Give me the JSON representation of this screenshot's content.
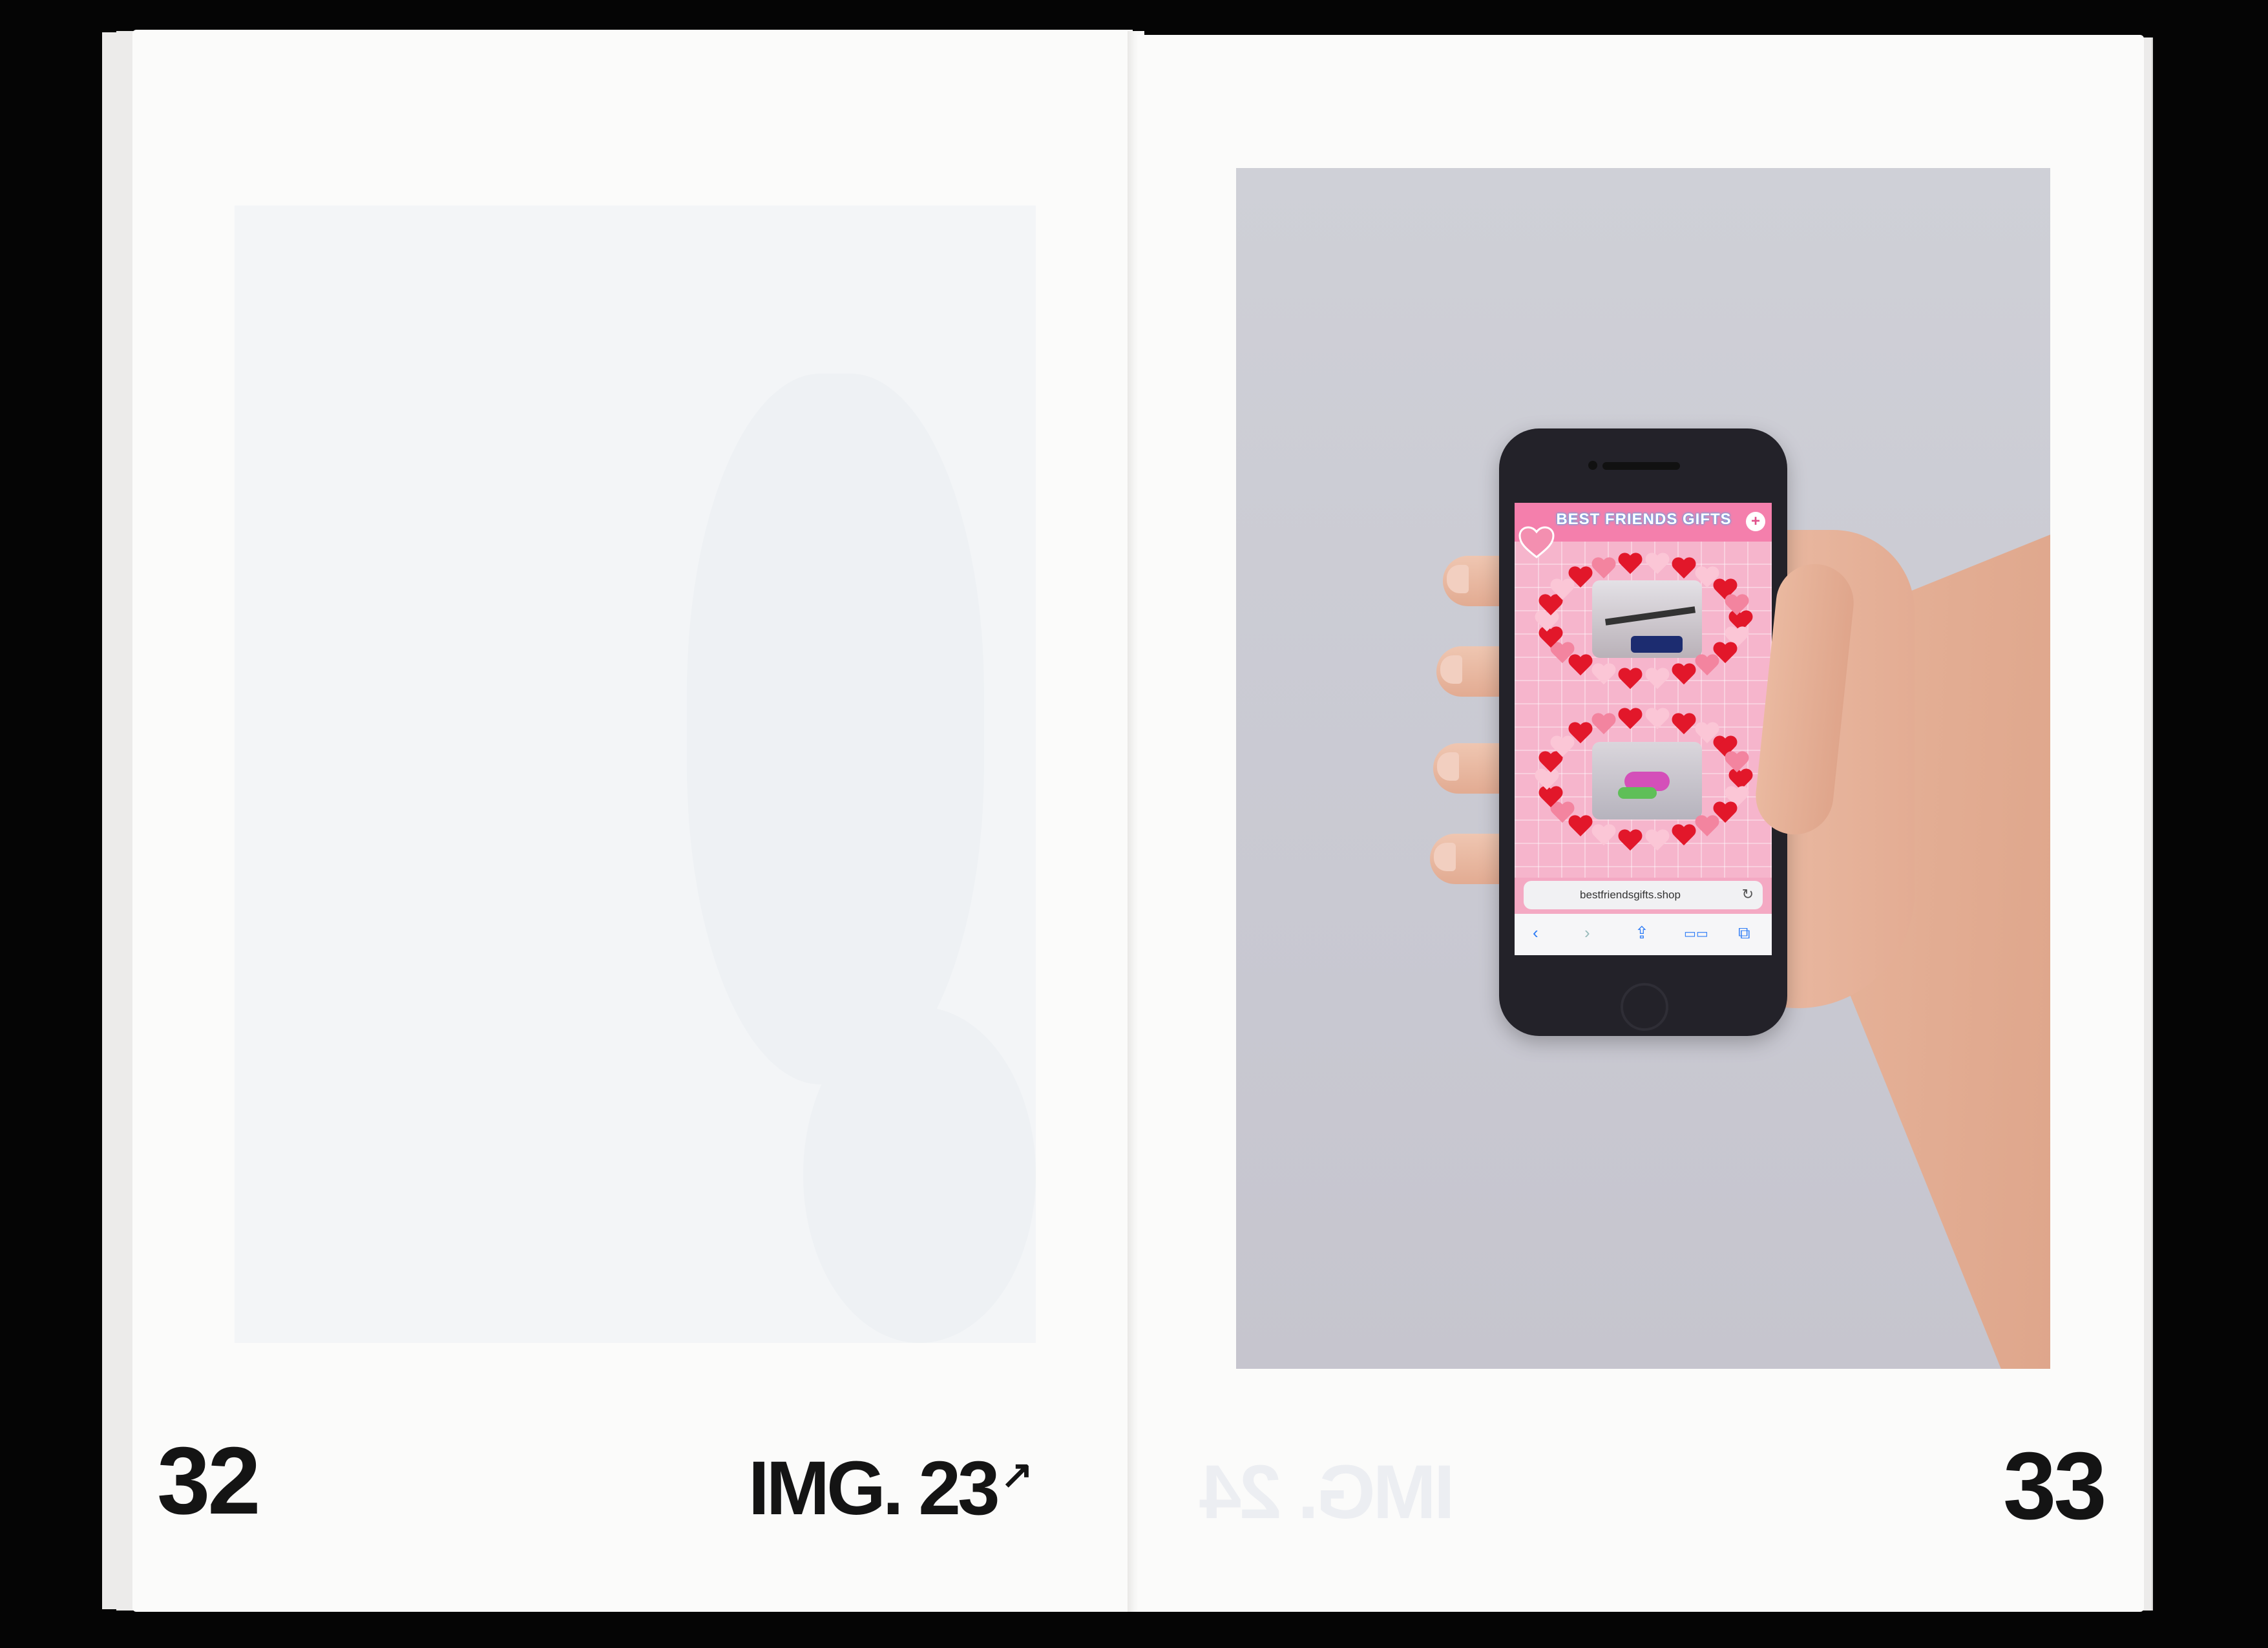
{
  "spread": {
    "left_page": {
      "page_number": "32",
      "caption": "IMG. 23",
      "caption_arrow": "↗"
    },
    "right_page": {
      "page_number": "33",
      "bleed_caption": "IMG. 24"
    }
  },
  "phone_screen": {
    "site_title": "BEST FRIENDS GIFTS",
    "plus_label": "+",
    "url": "bestfriendsgifts.shop",
    "reload_icon": "↻",
    "toolbar_icons": {
      "back": "‹",
      "forward": "›",
      "share": "⇪",
      "bookmarks": "▭▭",
      "tabs": "⧉"
    }
  },
  "colors": {
    "accent_pink": "#f47fac",
    "heart_red": "#e2172a",
    "ios_blue": "#2e7cf6"
  }
}
